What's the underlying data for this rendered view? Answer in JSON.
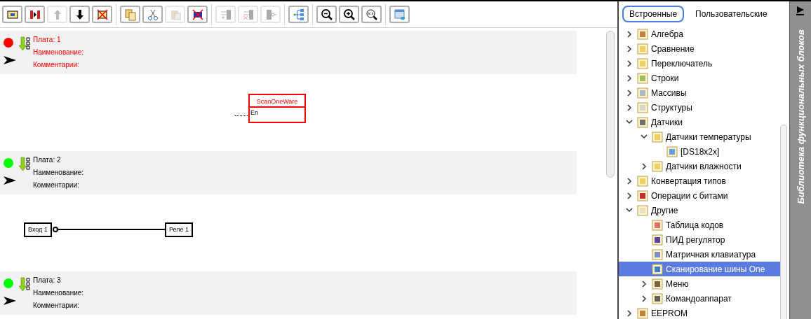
{
  "toolbar": [
    {
      "kind": "board-add",
      "disabled": false
    },
    {
      "kind": "board-split",
      "disabled": false
    },
    {
      "kind": "up",
      "disabled": true
    },
    {
      "kind": "down",
      "disabled": false
    },
    {
      "kind": "board-delete",
      "disabled": false
    },
    {
      "kind": "copy",
      "disabled": false
    },
    {
      "kind": "cut",
      "disabled": false
    },
    {
      "kind": "paste",
      "disabled": true
    },
    {
      "kind": "delete",
      "disabled": false
    },
    {
      "kind": "add-input",
      "disabled": true
    },
    {
      "kind": "remove-input",
      "disabled": true
    },
    {
      "kind": "invert",
      "disabled": true
    },
    {
      "kind": "tree",
      "disabled": false
    },
    {
      "kind": "zoom-out",
      "disabled": false
    },
    {
      "kind": "zoom-in",
      "disabled": false
    },
    {
      "kind": "zoom-reset",
      "disabled": false
    },
    {
      "kind": "view",
      "disabled": false
    }
  ],
  "boards": [
    {
      "color": "#ff0000",
      "error": true,
      "board": "Плата: 1",
      "name": "Наименование:",
      "comment": "Комментарии:",
      "diagram": {
        "kind": "block",
        "title": "ScanOneWare",
        "input": "En"
      }
    },
    {
      "color": "#00ff00",
      "error": false,
      "board": "Плата: 2",
      "name": "Наименование:",
      "comment": "Комментарии:",
      "diagram": {
        "kind": "link",
        "from": "Вход 1",
        "to": "Реле 1"
      }
    },
    {
      "color": "#00ff00",
      "error": false,
      "board": "Плата: 3",
      "name": "Наименование:",
      "comment": "Комментарии:"
    }
  ],
  "library": {
    "tabs": [
      {
        "label": "Встроенные",
        "selected": true
      },
      {
        "label": "Пользовательские",
        "selected": false
      }
    ],
    "tree": [
      {
        "label": "Алгебра",
        "expanded": false
      },
      {
        "label": "Сравнение",
        "expanded": false
      },
      {
        "label": "Переключатель",
        "expanded": false
      },
      {
        "label": "Строки",
        "expanded": false
      },
      {
        "label": "Массивы",
        "expanded": false
      },
      {
        "label": "Структуры",
        "expanded": false
      },
      {
        "label": "Датчики",
        "expanded": true,
        "children": [
          {
            "label": "Датчики температуры",
            "expanded": true,
            "children": [
              {
                "label": "[DS18x2x]",
                "selected": false
              }
            ]
          },
          {
            "label": "Датчики влажности",
            "expanded": false
          }
        ]
      },
      {
        "label": "Конвертация типов",
        "expanded": false
      },
      {
        "label": "Операции с битами",
        "expanded": false
      },
      {
        "label": "Другие",
        "expanded": true,
        "children": [
          {
            "label": "Таблица кодов",
            "selected": false
          },
          {
            "label": "ПИД регулятор",
            "selected": false
          },
          {
            "label": "Матричная клавиатура",
            "selected": false
          },
          {
            "label": "Сканирование шины One",
            "selected": true
          },
          {
            "label": "Меню",
            "expanded": false
          },
          {
            "label": "Командоаппарат",
            "expanded": false
          }
        ]
      },
      {
        "label": "EEPROM",
        "expanded": false
      }
    ],
    "side_title": "Библиотека функциональных блоков"
  }
}
